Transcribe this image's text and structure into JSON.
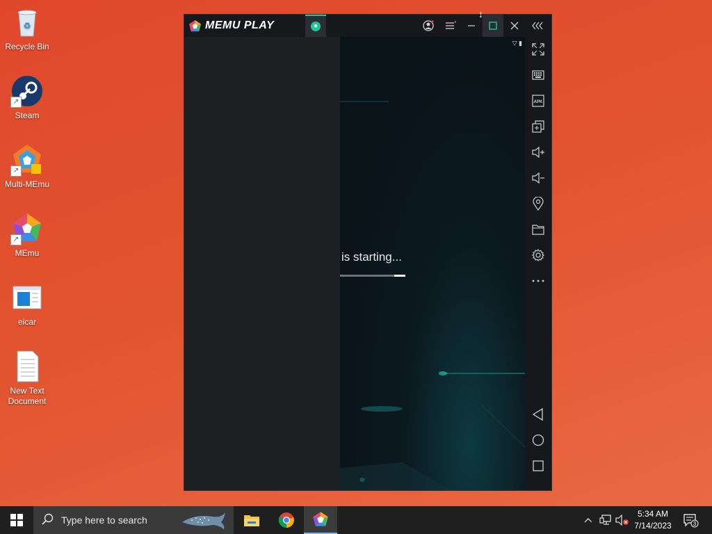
{
  "desktop": {
    "icons": [
      {
        "label": "Recycle Bin"
      },
      {
        "label": "Steam"
      },
      {
        "label": "Multi-MEmu"
      },
      {
        "label": "MEmu"
      },
      {
        "label": "eicar"
      },
      {
        "label": "New Text Document"
      }
    ]
  },
  "memu": {
    "logo_text": "MEMU PLAY",
    "screen": {
      "starting_text": "is starting...",
      "progress_fraction": 0.17
    },
    "sidebar_icons": [
      "fullscreen-icon",
      "keyboard-icon",
      "apk-icon",
      "multi-window-icon",
      "volume-up-icon",
      "volume-down-icon",
      "location-icon",
      "folder-icon",
      "settings-icon",
      "more-icon",
      "back-icon",
      "home-icon",
      "recents-icon"
    ],
    "accent": "#1fc5a0"
  },
  "taskbar": {
    "search_placeholder": "Type here to search",
    "clock_time": "5:34 AM",
    "clock_date": "7/14/2023",
    "notification_count": "3"
  }
}
